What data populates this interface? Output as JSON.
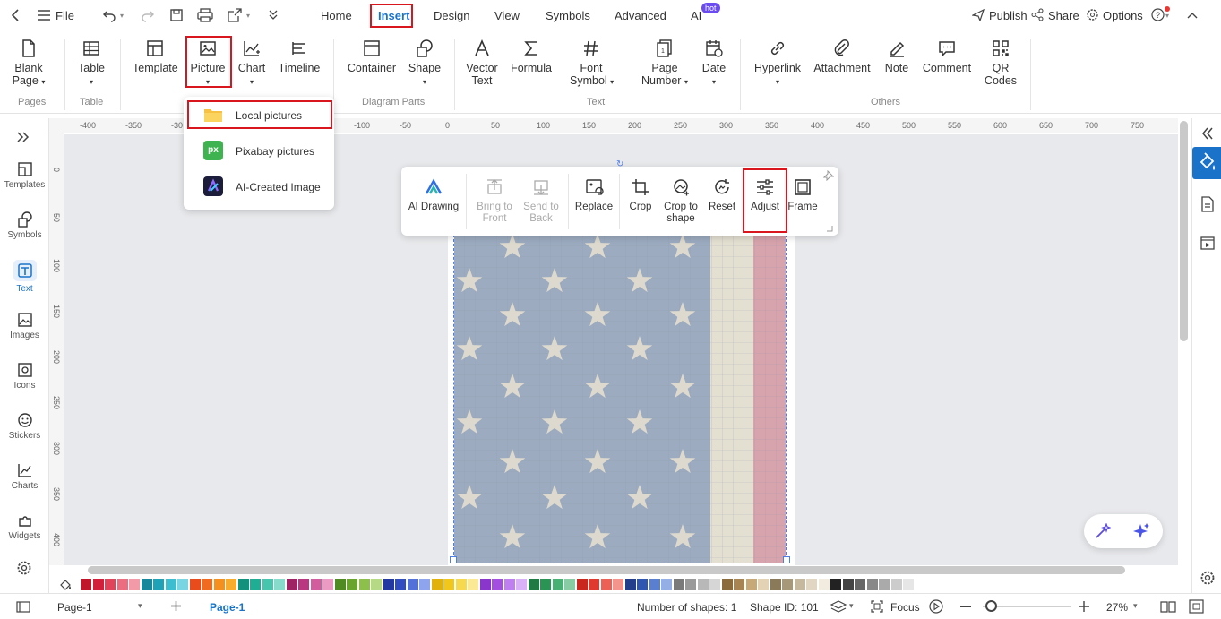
{
  "menubar": {
    "file_label": "File",
    "tabs": [
      "Home",
      "Insert",
      "Design",
      "View",
      "Symbols",
      "Advanced",
      "AI"
    ],
    "hot_badge": "hot",
    "publish_label": "Publish",
    "share_label": "Share",
    "options_label": "Options"
  },
  "ribbon": {
    "blank_page": [
      "Blank",
      "Page"
    ],
    "table": "Table",
    "template": "Template",
    "picture": "Picture",
    "chart": "Chart",
    "timeline": "Timeline",
    "container": "Container",
    "shape": "Shape",
    "vector_text": [
      "Vector",
      "Text"
    ],
    "formula": "Formula",
    "font_symbol": [
      "Font",
      "Symbol"
    ],
    "page_number": [
      "Page",
      "Number"
    ],
    "date": "Date",
    "hyperlink": "Hyperlink",
    "attachment": "Attachment",
    "note": "Note",
    "comment": "Comment",
    "qr_codes": [
      "QR",
      "Codes"
    ],
    "groups": {
      "pages": "Pages",
      "table": "Table",
      "diagram_parts": "Diagram Parts",
      "text": "Text",
      "others": "Others"
    }
  },
  "picture_menu": {
    "items": [
      "Local pictures",
      "Pixabay pictures",
      "AI-Created Image"
    ],
    "pixabay_badge": "px"
  },
  "image_toolbar": {
    "ai_drawing": "AI Drawing",
    "bring_to_front": [
      "Bring to",
      "Front"
    ],
    "send_to_back": [
      "Send to",
      "Back"
    ],
    "replace": "Replace",
    "crop": "Crop",
    "crop_to_shape": [
      "Crop to",
      "shape"
    ],
    "reset": "Reset",
    "adjust": "Adjust",
    "frame": "Frame"
  },
  "left_sidebar": [
    "Templates",
    "Symbols",
    "Text",
    "Images",
    "Icons",
    "Stickers",
    "Charts",
    "Widgets"
  ],
  "ruler_h": [
    "-400",
    "-350",
    "-30",
    "-100",
    "-50",
    "0",
    "50",
    "100",
    "150",
    "200",
    "250",
    "300",
    "350",
    "400",
    "450",
    "500",
    "550",
    "600",
    "650",
    "700",
    "750"
  ],
  "ruler_v": [
    "0",
    "50",
    "100",
    "150",
    "200",
    "250",
    "300",
    "350",
    "400"
  ],
  "status": {
    "page_selector": "Page-1",
    "active_page_tab": "Page-1",
    "shape_count": "Number of shapes: 1",
    "shape_id": "Shape ID: 101",
    "focus": "Focus",
    "zoom": "27%"
  },
  "colors": {
    "accent": "#1a73c8",
    "highlight": "#d9151e",
    "palette": [
      "#c0162c",
      "#d21f3c",
      "#e0435a",
      "#ec6c80",
      "#f29aa8",
      "#17879c",
      "#1ea2b7",
      "#3cbdd0",
      "#7ad5e2",
      "#e84c1c",
      "#f06a1f",
      "#f58f1d",
      "#f7ac2d",
      "#12927d",
      "#1fae94",
      "#47c6ad",
      "#87dbcb",
      "#9e2364",
      "#bb3680",
      "#d35c9e",
      "#eb9bc3",
      "#4f8a23",
      "#69a52d",
      "#8cc04a",
      "#b6d985",
      "#2338a0",
      "#2f4cc0",
      "#5272d9",
      "#8ea4ec",
      "#e0b20b",
      "#f0c71a",
      "#f7d950",
      "#fbe996",
      "#8a35cc",
      "#a44fe0",
      "#bf7ff0",
      "#d9b1f7",
      "#1f7a43",
      "#2a9455",
      "#49b073",
      "#87cca2",
      "#c9271e",
      "#e03a2e",
      "#ec6055",
      "#f4958d",
      "#233f8c",
      "#2f56b0",
      "#5a7fd0",
      "#94aee6",
      "#7a7a7a",
      "#9a9a9a",
      "#b8b8b8",
      "#d6d6d6",
      "#8b6a3c",
      "#a88452",
      "#c7a978",
      "#e3d3b4",
      "#8a7a5a",
      "#a8987a",
      "#c6b89e",
      "#e0d6c2",
      "#f2ece0",
      "#222222",
      "#444444",
      "#666666",
      "#888888",
      "#aaaaaa",
      "#cccccc",
      "#e6e6e6"
    ]
  }
}
